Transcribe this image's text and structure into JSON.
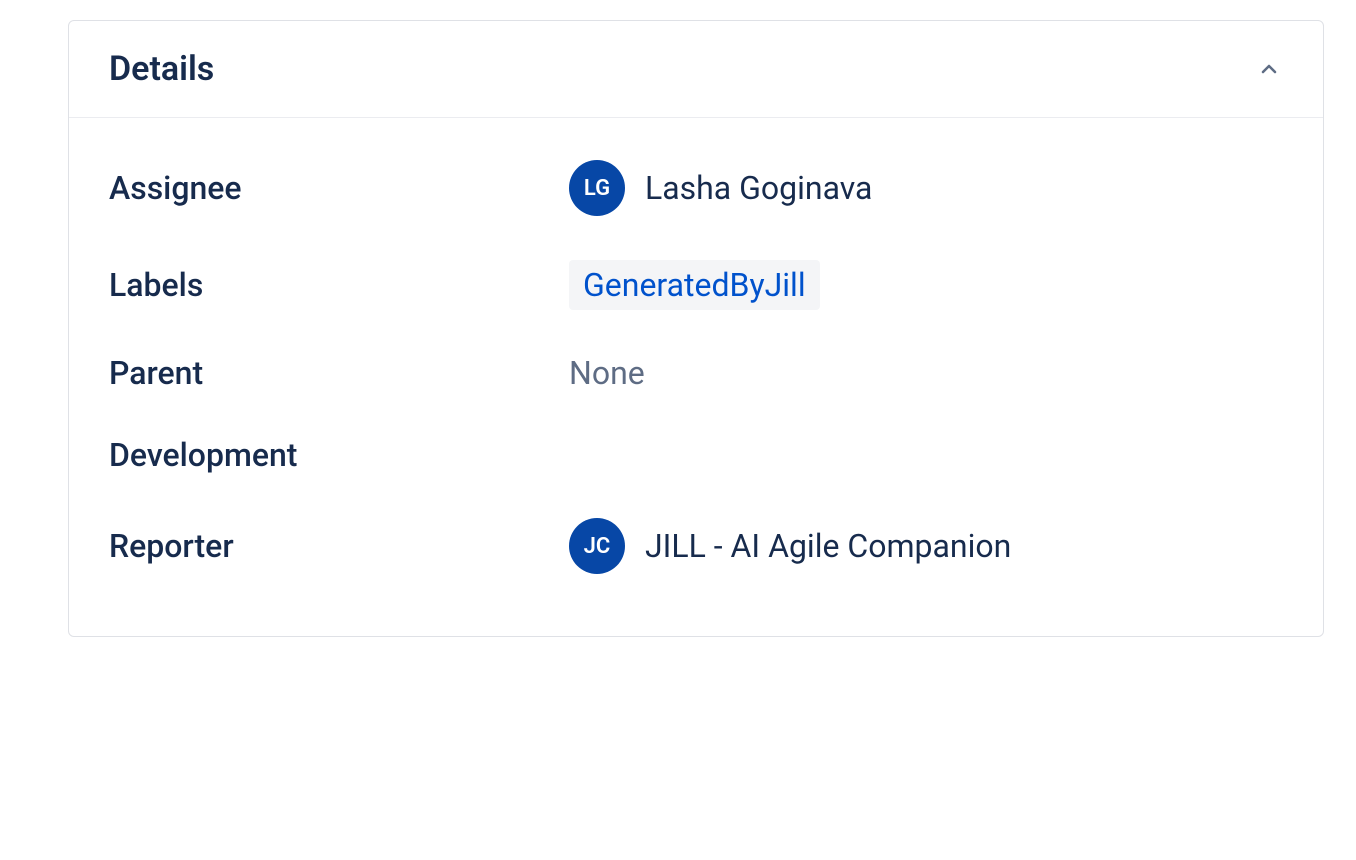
{
  "panel": {
    "title": "Details",
    "fields": {
      "assignee": {
        "label": "Assignee",
        "initials": "LG",
        "name": "Lasha Goginava"
      },
      "labels": {
        "label": "Labels",
        "tag": "GeneratedByJill"
      },
      "parent": {
        "label": "Parent",
        "value": "None"
      },
      "development": {
        "label": "Development"
      },
      "reporter": {
        "label": "Reporter",
        "initials": "JC",
        "name": "JILL - AI Agile Companion"
      }
    }
  }
}
